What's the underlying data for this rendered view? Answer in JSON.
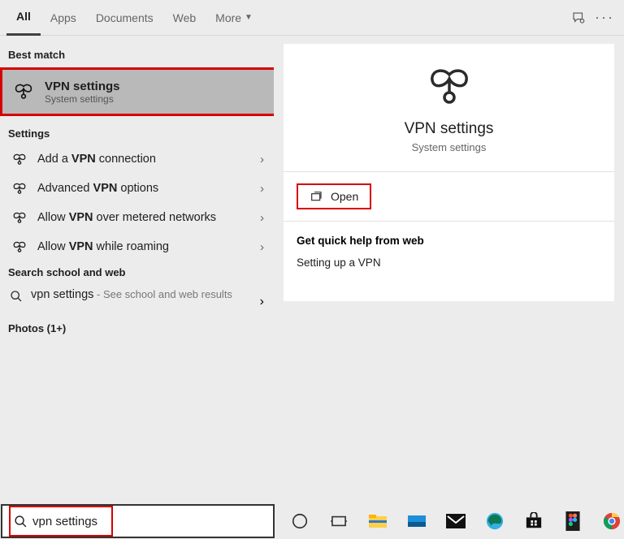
{
  "tabs": {
    "all": "All",
    "apps": "Apps",
    "documents": "Documents",
    "web": "Web",
    "more": "More"
  },
  "sections": {
    "bestmatch": "Best match",
    "settings": "Settings",
    "searchweb": "Search school and web",
    "photos": "Photos (1+)"
  },
  "best": {
    "title": "VPN settings",
    "subtitle": "System settings"
  },
  "settings_rows": {
    "r0": {
      "pre": "Add a ",
      "bold": "VPN",
      "post": " connection"
    },
    "r1": {
      "pre": "Advanced ",
      "bold": "VPN",
      "post": " options"
    },
    "r2": {
      "pre": "Allow ",
      "bold": "VPN",
      "post": " over metered networks"
    },
    "r3": {
      "pre": "Allow ",
      "bold": "VPN",
      "post": " while roaming"
    }
  },
  "web_row": {
    "query": "vpn settings",
    "suffix": " - See school and web results"
  },
  "detail": {
    "title": "VPN settings",
    "subtitle": "System settings",
    "open": "Open",
    "help_heading": "Get quick help from web",
    "help_link": "Setting up a VPN"
  },
  "search": {
    "value": "vpn settings"
  }
}
